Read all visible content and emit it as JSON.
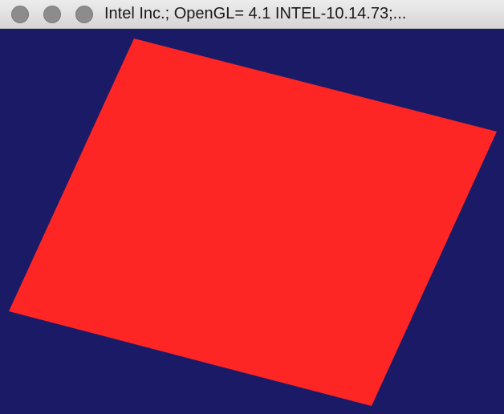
{
  "window": {
    "title": "Intel Inc.; OpenGL= 4.1 INTEL-10.14.73;..."
  },
  "controls": [
    {
      "name": "close",
      "icon": "window-close-circle"
    },
    {
      "name": "minimize",
      "icon": "window-minimize-circle"
    },
    {
      "name": "zoom",
      "icon": "window-zoom-circle"
    }
  ],
  "scene": {
    "background_color": "#1b1a67",
    "quad_color": "#fd2625"
  }
}
